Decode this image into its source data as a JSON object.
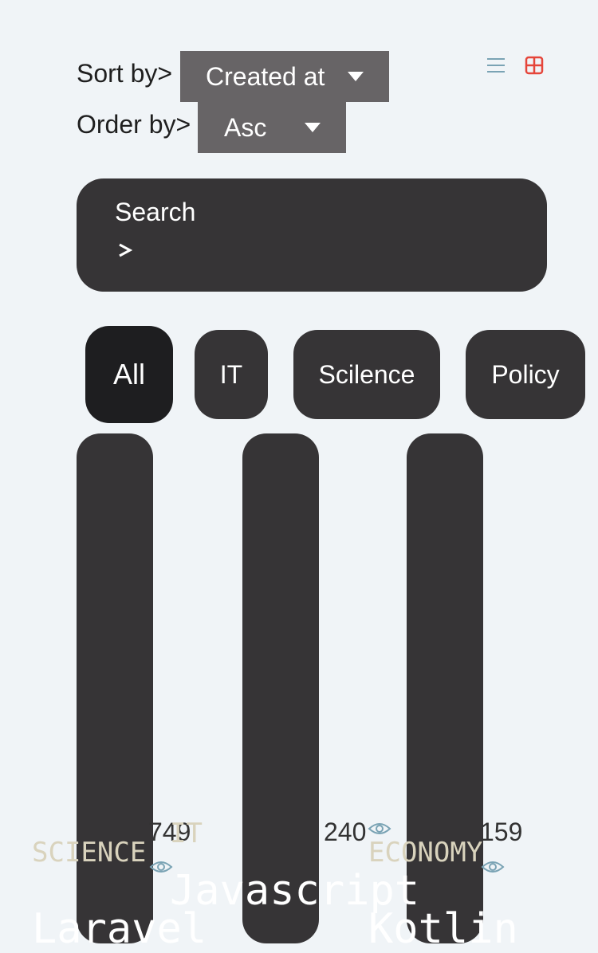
{
  "sort": {
    "label": "Sort by>",
    "value": "Created at"
  },
  "order": {
    "label": "Order by>",
    "value": "Asc"
  },
  "view_toggle": {
    "list_icon": "list-icon",
    "grid_icon": "grid-icon",
    "active": "grid",
    "active_color": "#e5453a",
    "inactive_color": "#7aa3b4"
  },
  "search": {
    "label": "Search",
    "prompt": ">"
  },
  "filters": [
    {
      "label": "All",
      "active": true
    },
    {
      "label": "IT",
      "active": false
    },
    {
      "label": "Scilence",
      "active": false
    },
    {
      "label": "Policy",
      "active": false
    }
  ],
  "cards": [
    {
      "views": "749",
      "category": "SCIENCE",
      "title": "Laravel"
    },
    {
      "views": "240",
      "category": "IT",
      "title": "Javascript"
    },
    {
      "views": "159",
      "category": "ECONOMY",
      "title": "Kotlin"
    }
  ],
  "colors": {
    "select_bg": "#676466",
    "dark_bg": "#363436",
    "chip_active_bg": "#1e1e20",
    "category_text": "#d9d3bd",
    "eye_icon": "#7aa3b4"
  }
}
